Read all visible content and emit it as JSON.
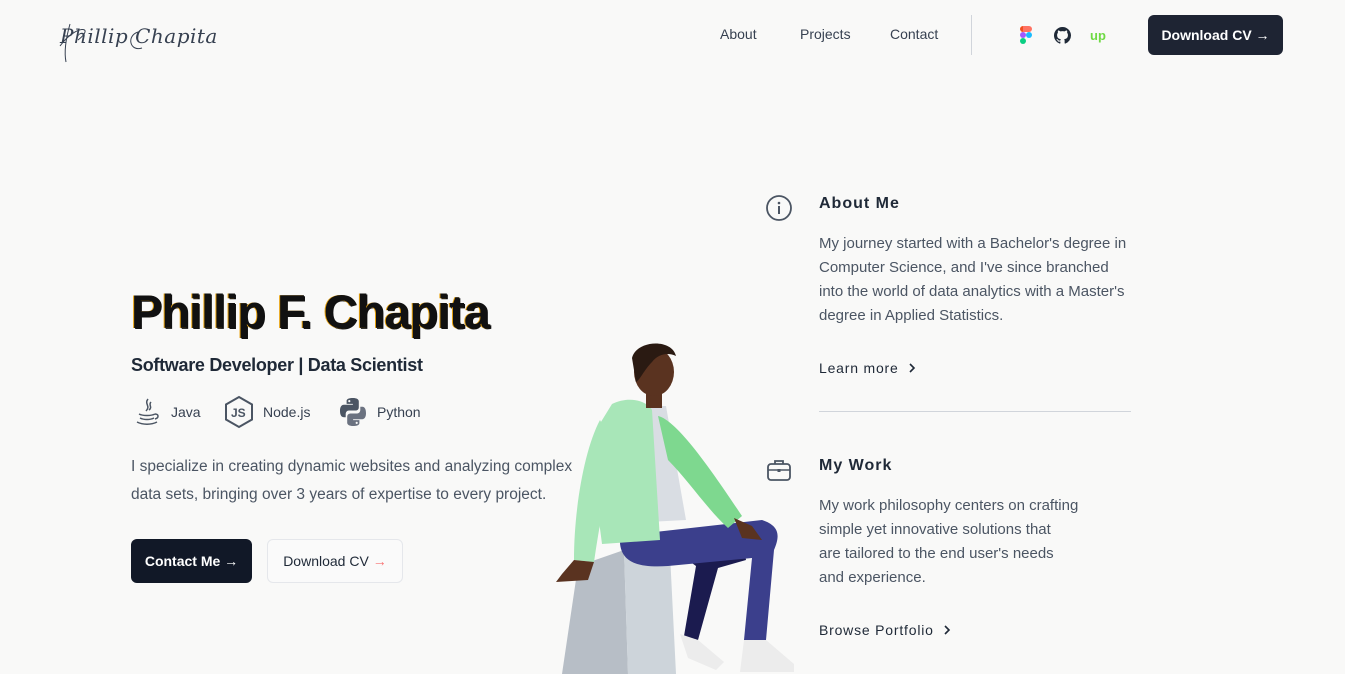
{
  "header": {
    "logo_text": "Phillip Chapita",
    "nav": [
      "About",
      "Projects",
      "Contact"
    ],
    "social_icons": [
      "figma-icon",
      "github-icon",
      "upwork-icon"
    ],
    "upwork_glyph": "up",
    "download_cv": "Download CV →"
  },
  "hero": {
    "name": "Phillip F. Chapita",
    "role": "Software Developer | Data Scientist",
    "tech": [
      {
        "label": "Java",
        "icon": "java-icon"
      },
      {
        "label": "Node.js",
        "icon": "nodejs-icon"
      },
      {
        "label": "Python",
        "icon": "python-icon"
      }
    ],
    "description": "I specialize in creating dynamic websites and analyzing complex data sets, bringing over 3 years of expertise to every project.",
    "contact_button": "Contact Me →",
    "download_button": "Download CV",
    "download_arrow": "→"
  },
  "about": {
    "title": "About Me",
    "body": "My journey started with a Bachelor's degree in Computer Science, and I've since branched into the world of data analytics with a Master's degree in Applied Statistics.",
    "link": "Learn more"
  },
  "work": {
    "title": "My Work",
    "body_lines": [
      "My work philosophy centers on crafting",
      "simple yet innovative solutions that",
      "are tailored to the end user's needs",
      "and experience."
    ],
    "link": "Browse Portfolio"
  },
  "colors": {
    "background": "#f9f9f8",
    "primary_dark": "#1e2433",
    "upwork_green": "#6fda44",
    "accent_red": "#f87171"
  }
}
